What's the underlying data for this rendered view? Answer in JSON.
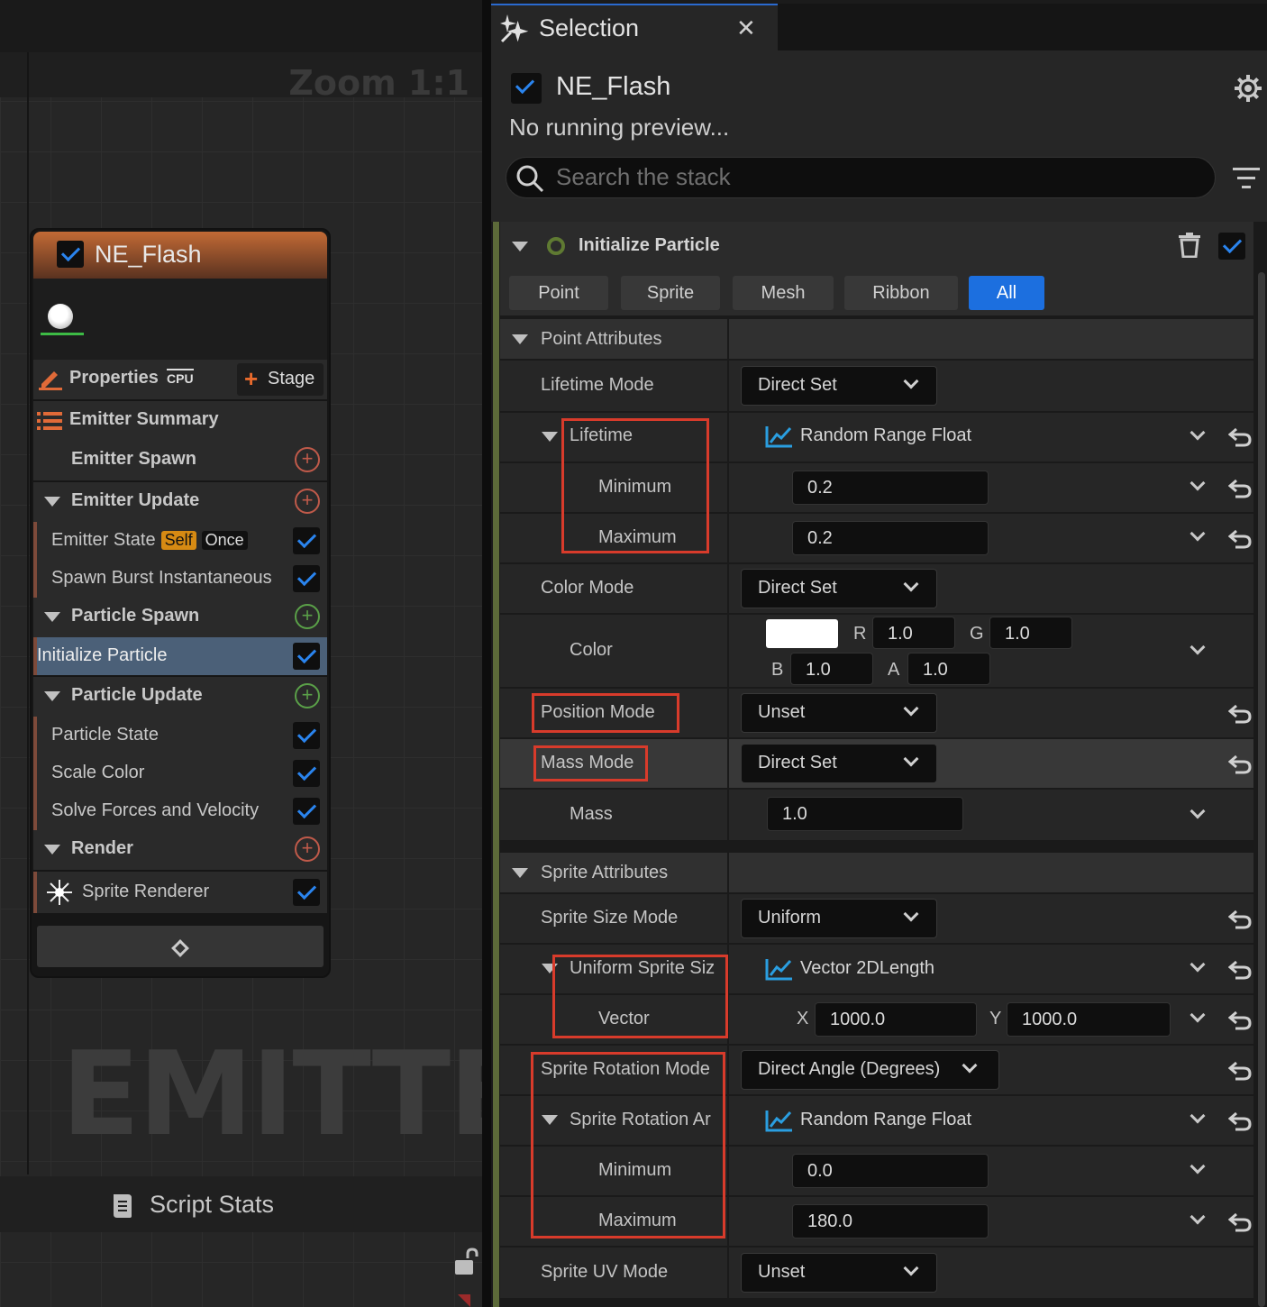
{
  "graph": {
    "zoom_label": "Zoom 1:1",
    "watermark": "EMITTER",
    "script_stats_label": "Script Stats",
    "node": {
      "title": "NE_Flash",
      "properties_label": "Properties",
      "cpu_label": "CPU",
      "stage_label": "Stage",
      "emitter_summary": "Emitter Summary",
      "emitter_spawn": "Emitter Spawn",
      "emitter_update": "Emitter Update",
      "emitter_state": "Emitter State",
      "badge_self": "Self",
      "badge_once": "Once",
      "spawn_burst": "Spawn Burst Instantaneous",
      "particle_spawn": "Particle Spawn",
      "initialize_particle": "Initialize Particle",
      "particle_update": "Particle Update",
      "particle_state": "Particle State",
      "scale_color": "Scale Color",
      "solve_forces": "Solve Forces and Velocity",
      "render": "Render",
      "sprite_renderer": "Sprite Renderer"
    }
  },
  "panel": {
    "tab_label": "Selection",
    "emitter_name": "NE_Flash",
    "preview_status": "No running preview...",
    "search_placeholder": "Search the stack",
    "module_title": "Initialize Particle",
    "filters": [
      "Point",
      "Sprite",
      "Mesh",
      "Ribbon",
      "All"
    ],
    "active_filter": "All",
    "point_attributes": "Point Attributes",
    "lifetime_mode_label": "Lifetime Mode",
    "lifetime_mode_value": "Direct Set",
    "lifetime_label": "Lifetime",
    "lifetime_type": "Random Range Float",
    "minimum_label": "Minimum",
    "maximum_label": "Maximum",
    "lifetime_min": "0.2",
    "lifetime_max": "0.2",
    "color_mode_label": "Color Mode",
    "color_mode_value": "Direct Set",
    "color_label": "Color",
    "color_r_label": "R",
    "color_r": "1.0",
    "color_g_label": "G",
    "color_g": "1.0",
    "color_b_label": "B",
    "color_b": "1.0",
    "color_a_label": "A",
    "color_a": "1.0",
    "swatch_color": "#ffffff",
    "position_mode_label": "Position Mode",
    "position_mode_value": "Unset",
    "mass_mode_label": "Mass Mode",
    "mass_mode_value": "Direct Set",
    "mass_label": "Mass",
    "mass_value": "1.0",
    "sprite_attributes": "Sprite Attributes",
    "sprite_size_mode_label": "Sprite Size Mode",
    "sprite_size_mode_value": "Uniform",
    "uniform_sprite_size_label": "Uniform Sprite Siz",
    "uniform_sprite_size_type": "Vector 2DLength",
    "vector_label": "Vector",
    "x_label": "X",
    "vector_x": "1000.0",
    "y_label": "Y",
    "vector_y": "1000.0",
    "sprite_rotation_mode_label": "Sprite Rotation Mode",
    "sprite_rotation_mode_value": "Direct Angle (Degrees)",
    "sprite_rotation_angle_label": "Sprite Rotation Ar",
    "sprite_rotation_angle_type": "Random Range Float",
    "rotation_min": "0.0",
    "rotation_max": "180.0",
    "sprite_uv_mode_label": "Sprite UV Mode",
    "sprite_uv_mode_value": "Unset"
  },
  "colors": {
    "accent_blue": "#1c6fdf",
    "highlight_red": "#d83b2b",
    "node_header": "#c26a35",
    "selected_row": "#4b6078"
  }
}
